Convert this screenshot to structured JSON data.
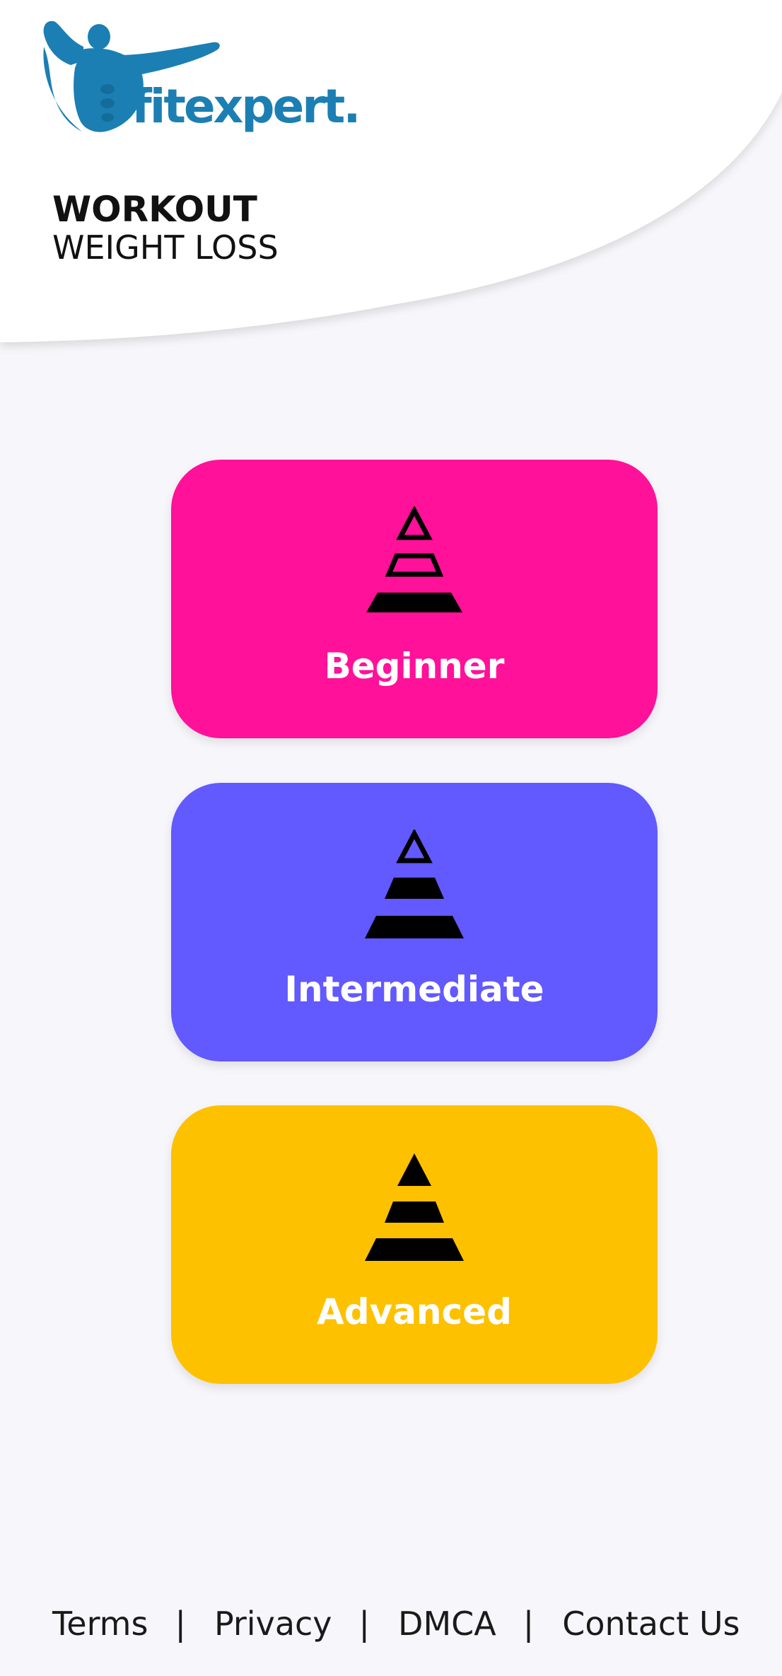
{
  "brand": {
    "logo_text": "fitexpert.",
    "logo_color": "#1b7fb3"
  },
  "header": {
    "title": "WORKOUT",
    "subtitle": "WEIGHT LOSS"
  },
  "levels": [
    {
      "label": "Beginner",
      "color": "#ff1199",
      "icon": "pyramid-beginner-icon"
    },
    {
      "label": "Intermediate",
      "color": "#6259ff",
      "icon": "pyramid-intermediate-icon"
    },
    {
      "label": "Advanced",
      "color": "#fdc100",
      "icon": "pyramid-advanced-icon"
    }
  ],
  "footer": {
    "links": [
      "Terms",
      "Privacy",
      "DMCA",
      "Contact Us"
    ],
    "separator": "|"
  }
}
